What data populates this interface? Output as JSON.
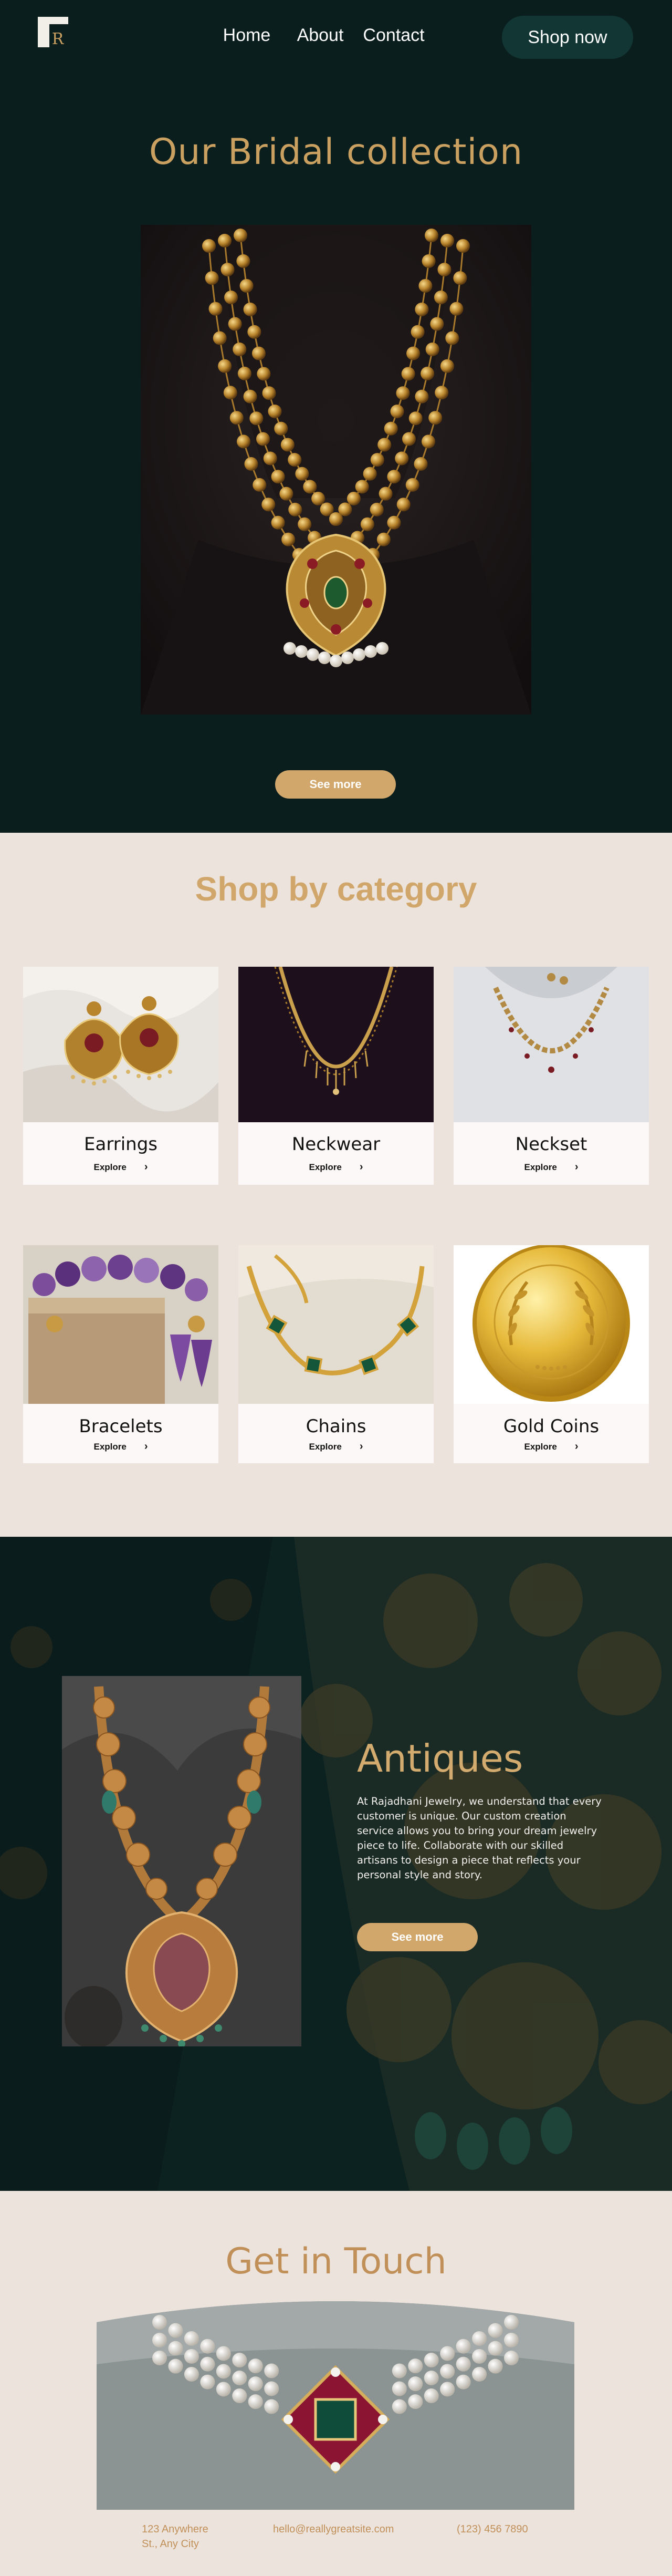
{
  "nav": {
    "logo_letter": "R",
    "links": [
      {
        "label": "Home"
      },
      {
        "label": "About"
      },
      {
        "label": "Contact"
      }
    ],
    "cta_label": "Shop now"
  },
  "hero": {
    "title": "Our Bridal collection",
    "image_alt": "gold-multi-strand-necklace",
    "button_label": "See more"
  },
  "category": {
    "title": "Shop by category",
    "explore_label": "Explore",
    "items": [
      {
        "label": "Earrings"
      },
      {
        "label": "Neckwear"
      },
      {
        "label": "Neckset"
      },
      {
        "label": "Bracelets"
      },
      {
        "label": "Chains"
      },
      {
        "label": "Gold Coins"
      }
    ]
  },
  "antiques": {
    "title": "Antiques",
    "description": "At Rajadhani Jewelry, we understand that every customer is unique. Our custom creation service allows you to bring your dream jewelry piece to life. Collaborate with our skilled artisans to design a piece that reflects your personal style and story.",
    "button_label": "See more"
  },
  "contact": {
    "title": "Get in Touch",
    "address": "123 Anywhere St., Any City",
    "email": "hello@reallygreatsite.com",
    "phone": "(123) 456 7890"
  },
  "colors": {
    "dark_bg": "#0a1e1d",
    "gold": "#c9a05f",
    "button_gold": "#d2a76b",
    "cream_bg": "#ede3dd",
    "card_bg": "#fcf8f7",
    "shop_button": "#123634"
  }
}
